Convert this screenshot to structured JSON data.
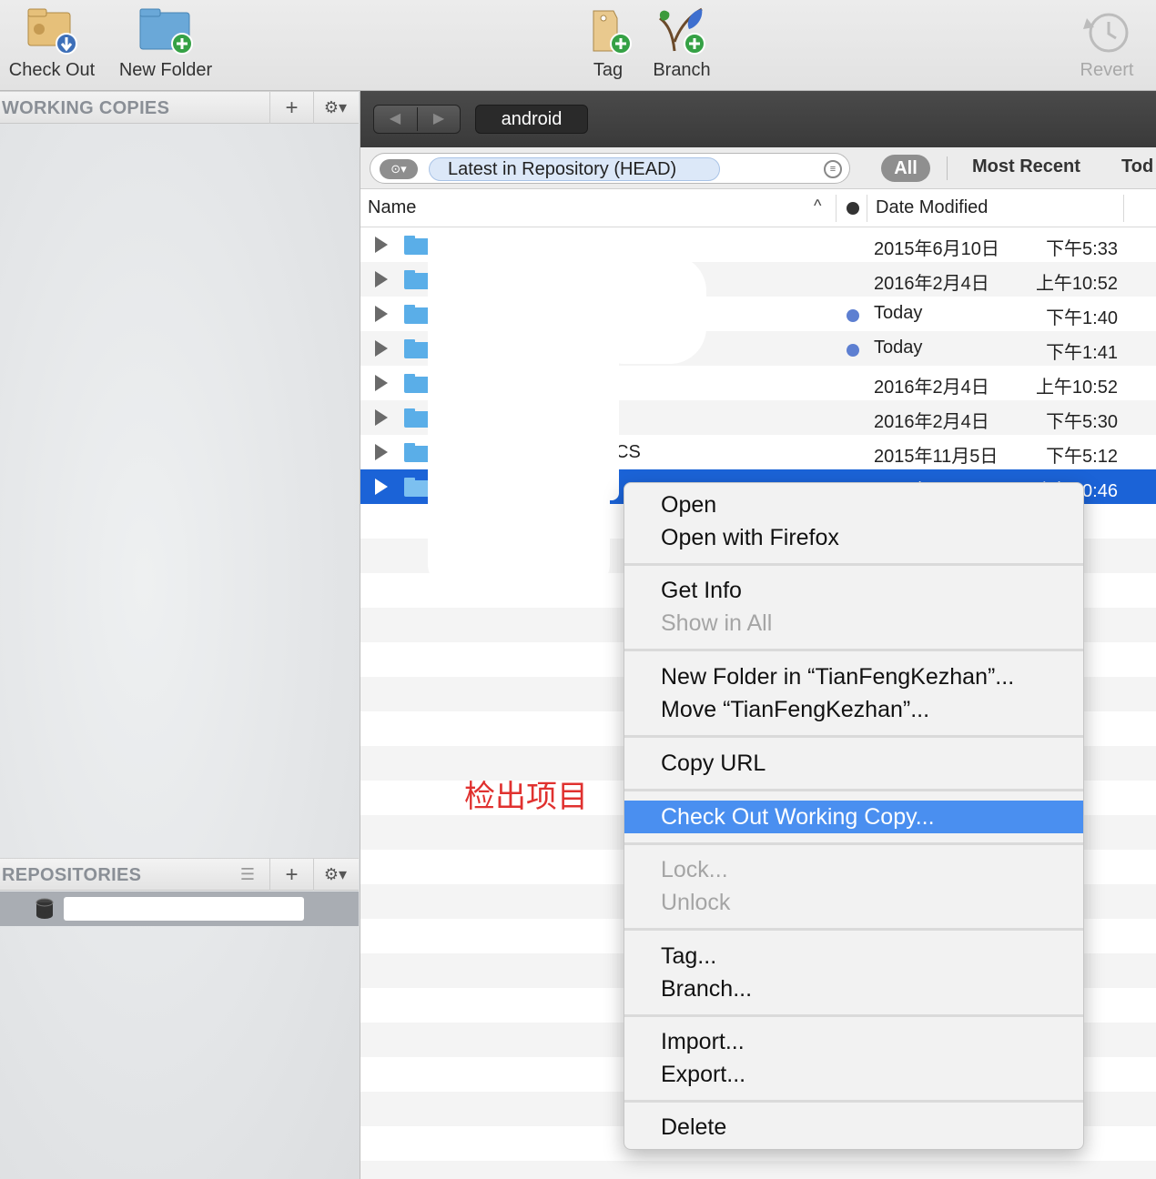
{
  "toolbar": {
    "check_out": "Check Out",
    "new_folder": "New Folder",
    "tag": "Tag",
    "branch": "Branch",
    "revert": "Revert"
  },
  "sidebar": {
    "working_copies": "WORKING COPIES",
    "repositories": "REPOSITORIES",
    "add": "+",
    "gear": "⚙▾",
    "list": "☰"
  },
  "path": {
    "back": "◀",
    "forward": "▶",
    "crumb": "android"
  },
  "filter": {
    "revision": "Latest in Repository (HEAD)",
    "scope_all": "All",
    "scope_recent": "Most Recent",
    "scope_today": "Tod"
  },
  "columns": {
    "name": "Name",
    "sort": "^",
    "date_modified": "Date Modified"
  },
  "rows": [
    {
      "name": "",
      "date": "2015年6月10日",
      "time": "下午5:33",
      "dot": false
    },
    {
      "name": "",
      "date": "2016年2月4日",
      "time": "上午10:52",
      "dot": false
    },
    {
      "name": "",
      "date": "Today",
      "time": "下午1:40",
      "dot": true
    },
    {
      "name": "",
      "date": "Today",
      "time": "下午1:41",
      "dot": true
    },
    {
      "name": "",
      "date": "2016年2月4日",
      "time": "上午10:52",
      "dot": false
    },
    {
      "name": "T",
      "date": "2016年2月4日",
      "time": "下午5:30",
      "dot": false
    },
    {
      "name": "CS",
      "date": "2015年11月5日",
      "time": "下午5:12",
      "dot": false
    },
    {
      "name": "",
      "date": "2016年2月4日",
      "time": "上午10:46",
      "dot": false
    }
  ],
  "annotation": "检出项目",
  "menu": {
    "open": "Open",
    "open_with": "Open with Firefox",
    "get_info": "Get Info",
    "show_in_all": "Show in All",
    "new_folder_in": "New Folder in “TianFengKezhan”...",
    "move": "Move “TianFengKezhan”...",
    "copy_url": "Copy URL",
    "check_out_wc": "Check Out Working Copy...",
    "lock": "Lock...",
    "unlock": "Unlock",
    "tag": "Tag...",
    "branch": "Branch...",
    "import": "Import...",
    "export": "Export...",
    "delete": "Delete"
  },
  "colors": {
    "selection": "#1b63d7",
    "menu_highlight": "#4a8ff0",
    "annotation": "#e0312f"
  }
}
